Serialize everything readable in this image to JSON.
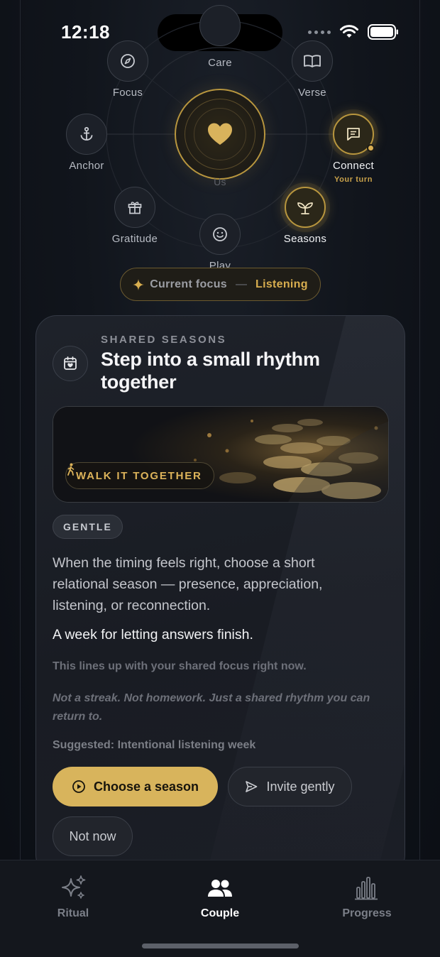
{
  "status_bar": {
    "time": "12:18"
  },
  "constellation": {
    "center_label": "Us",
    "nodes": {
      "care": {
        "label": "Care"
      },
      "focus": {
        "label": "Focus"
      },
      "verse": {
        "label": "Verse"
      },
      "anchor": {
        "label": "Anchor"
      },
      "connect": {
        "label": "Connect",
        "sublabel": "Your turn"
      },
      "gratitude": {
        "label": "Gratitude"
      },
      "play": {
        "label": "Play"
      },
      "seasons": {
        "label": "Seasons"
      }
    },
    "current_focus": {
      "prefix": "Current focus",
      "separator": "—",
      "value": "Listening"
    }
  },
  "card": {
    "eyebrow": "SHARED SEASONS",
    "title": "Step into a small rhythm together",
    "hero_chip": "WALK IT TOGETHER",
    "tag": "GENTLE",
    "description": "When the timing feels right, choose a short relational season — presence, appreciation, listening, or reconnection.",
    "highlight": "A week for letting answers finish.",
    "note_alignment": "This lines up with your shared focus right now.",
    "note_reassurance": "Not a streak. Not homework. Just a shared rhythm you can return to.",
    "suggestion": "Suggested: Intentional listening week",
    "primary_button": "Choose a season",
    "secondary_button": "Invite gently",
    "tertiary_button": "Not now"
  },
  "tabbar": {
    "tabs": [
      {
        "label": "Ritual",
        "icon": "sparkles-icon",
        "active": false
      },
      {
        "label": "Couple",
        "icon": "people-icon",
        "active": true
      },
      {
        "label": "Progress",
        "icon": "bar-chart-icon",
        "active": false
      }
    ]
  },
  "colors": {
    "accent": "#d8b45c",
    "background": "#11151c",
    "card": "#1c1f26"
  }
}
